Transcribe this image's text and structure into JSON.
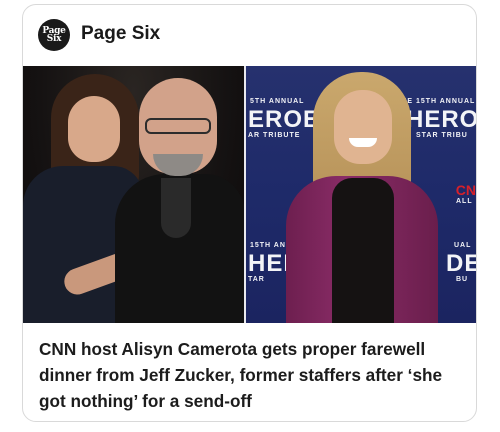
{
  "source": {
    "logo_text_top": "Page",
    "logo_text_bottom": "Six",
    "name": "Page Six"
  },
  "image": {
    "left_photo": "",
    "right_photo": "",
    "backdrop": {
      "annual_left": "5TH ANNUAL",
      "heroes_left": "EROES",
      "tribute_left": "AR TRIBUTE",
      "annual_right": "THE 15TH ANNUAL",
      "heroes_right": "HEROE",
      "tribute_right": "STAR TRIBU",
      "annual_bottom_left": "15TH AN",
      "heroes_bottom_left": "HER",
      "tribute_bottom_left": "TAR",
      "annual_bottom_right": "UAL",
      "heroes_bottom_right": "DE",
      "tribute_bottom_right": "BU",
      "network_logo": "CN",
      "network_sub": "ALL"
    }
  },
  "headline": "CNN host Alisyn Camerota gets proper farewell dinner from Jeff Zucker, former staffers after ‘she got nothing’ for a send-off"
}
